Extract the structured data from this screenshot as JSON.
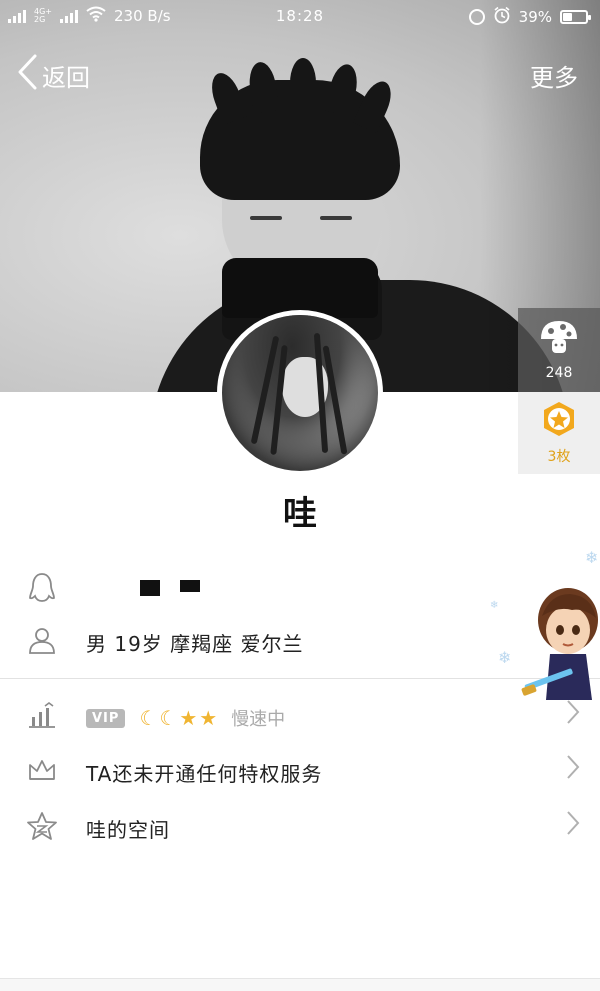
{
  "status_bar": {
    "network_type_top": "4G+",
    "network_type_bottom": "2G",
    "speed": "230 B/s",
    "time": "18:28",
    "battery": "39%"
  },
  "nav": {
    "back_label": "返回",
    "more_label": "更多"
  },
  "side": {
    "mushroom_count": "248",
    "coin_count": "3枚"
  },
  "profile": {
    "nickname": "哇",
    "details": "男  19岁  摩羯座  爱尔兰"
  },
  "vip": {
    "tag": "VIP",
    "speed_text": "慢速中"
  },
  "menu": {
    "privilege_label": "TA还未开通任何特权服务",
    "space_label": "哇的空间"
  },
  "colors": {
    "gold": "#f0b532",
    "grey_text": "#aaaaaa",
    "panel_grey": "#5a5a5a"
  }
}
